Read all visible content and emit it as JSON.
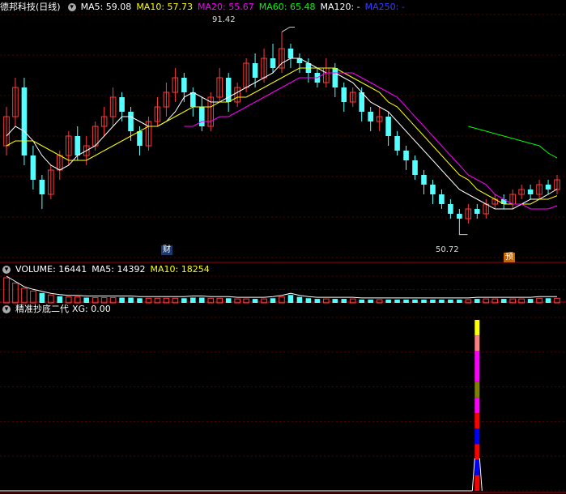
{
  "header": {
    "stock_name": "德邦科技",
    "period": "(日线)",
    "ma_labels": [
      {
        "text": "MA5: 59.08",
        "color": "#ffffff"
      },
      {
        "text": "MA10: 57.73",
        "color": "#ffff00"
      },
      {
        "text": "MA20: 55.67",
        "color": "#ff00ff"
      },
      {
        "text": "MA60: 65.48",
        "color": "#00ff00"
      },
      {
        "text": "MA120: -",
        "color": "#ffffff"
      },
      {
        "text": "MA250: -",
        "color": "#3b3bff"
      }
    ]
  },
  "volume_header": {
    "title": "VOLUME: 16441",
    "ma5": "MA5: 14392",
    "ma10": "MA10: 18254"
  },
  "indicator_header": {
    "title": "精准抄底二代",
    "xg": "XG: 0.00"
  },
  "markers": {
    "high": "91.42",
    "low": "50.72",
    "cai": "财",
    "yu": "预"
  },
  "colors": {
    "up": "#ff3b3b",
    "down": "#54ffff",
    "grid": "#5a0000",
    "ma5": "#ffffff",
    "ma10": "#ffff00",
    "ma20": "#ff00ff",
    "ma60": "#00ff00"
  },
  "chart_data": [
    {
      "type": "candlestick",
      "title": "德邦科技 (日线)",
      "ylim": [
        45,
        95
      ],
      "candles": [
        [
          68,
          74,
          66,
          76,
          "up"
        ],
        [
          74,
          80,
          72,
          82,
          "up"
        ],
        [
          80,
          66,
          64,
          82,
          "down"
        ],
        [
          66,
          61,
          59,
          68,
          "down"
        ],
        [
          61,
          58,
          55,
          62,
          "down"
        ],
        [
          58,
          63,
          57,
          64,
          "up"
        ],
        [
          63,
          66,
          61,
          67,
          "up"
        ],
        [
          66,
          70,
          64,
          71,
          "up"
        ],
        [
          70,
          66,
          65,
          72,
          "down"
        ],
        [
          66,
          68,
          64,
          70,
          "up"
        ],
        [
          68,
          72,
          67,
          73,
          "up"
        ],
        [
          72,
          74,
          70,
          76,
          "up"
        ],
        [
          74,
          78,
          72,
          80,
          "up"
        ],
        [
          78,
          75,
          73,
          79,
          "down"
        ],
        [
          75,
          71,
          69,
          76,
          "down"
        ],
        [
          71,
          68,
          66,
          72,
          "down"
        ],
        [
          68,
          73,
          67,
          74,
          "up"
        ],
        [
          73,
          76,
          72,
          78,
          "up"
        ],
        [
          76,
          79,
          74,
          81,
          "up"
        ],
        [
          79,
          82,
          77,
          84,
          "up"
        ],
        [
          82,
          79,
          77,
          83,
          "down"
        ],
        [
          79,
          76,
          74,
          80,
          "down"
        ],
        [
          76,
          72,
          71,
          78,
          "down"
        ],
        [
          72,
          78,
          71,
          79,
          "up"
        ],
        [
          78,
          82,
          77,
          84,
          "up"
        ],
        [
          82,
          77,
          75,
          83,
          "down"
        ],
        [
          77,
          80,
          76,
          81,
          "up"
        ],
        [
          80,
          85,
          79,
          86,
          "up"
        ],
        [
          85,
          82,
          80,
          87,
          "down"
        ],
        [
          82,
          86,
          81,
          88,
          "up"
        ],
        [
          86,
          84,
          83,
          89,
          "down"
        ],
        [
          84,
          88,
          83,
          91.42,
          "up"
        ],
        [
          88,
          86,
          84,
          89,
          "down"
        ],
        [
          86,
          85,
          83,
          87,
          "down"
        ],
        [
          85,
          83,
          81,
          86,
          "down"
        ],
        [
          83,
          81,
          80,
          84,
          "down"
        ],
        [
          81,
          84,
          80,
          86,
          "up"
        ],
        [
          84,
          80,
          78,
          85,
          "down"
        ],
        [
          80,
          77,
          75,
          81,
          "down"
        ],
        [
          77,
          79,
          76,
          80,
          "up"
        ],
        [
          79,
          75,
          73,
          80,
          "down"
        ],
        [
          75,
          73,
          71,
          76,
          "down"
        ],
        [
          73,
          74,
          71,
          76,
          "up"
        ],
        [
          74,
          70,
          68,
          75,
          "down"
        ],
        [
          70,
          67,
          66,
          71,
          "down"
        ],
        [
          67,
          65,
          63,
          68,
          "down"
        ],
        [
          65,
          62,
          61,
          66,
          "down"
        ],
        [
          62,
          60,
          58,
          63,
          "down"
        ],
        [
          60,
          58,
          56,
          61,
          "down"
        ],
        [
          58,
          56,
          55,
          59,
          "down"
        ],
        [
          56,
          54,
          53,
          57,
          "down"
        ],
        [
          54,
          53,
          50.72,
          55,
          "down"
        ],
        [
          53,
          55,
          52,
          56,
          "up"
        ],
        [
          55,
          54,
          53,
          56,
          "down"
        ],
        [
          54,
          56,
          53,
          57,
          "up"
        ],
        [
          56,
          57,
          55,
          58,
          "up"
        ],
        [
          57,
          56,
          55,
          58,
          "down"
        ],
        [
          56,
          58,
          55,
          59,
          "up"
        ],
        [
          58,
          59,
          57,
          60,
          "up"
        ],
        [
          59,
          58,
          57,
          60,
          "down"
        ],
        [
          58,
          60,
          57,
          61,
          "up"
        ],
        [
          60,
          59,
          58,
          61,
          "down"
        ],
        [
          59,
          61,
          58,
          62,
          "up"
        ]
      ],
      "series": [
        {
          "name": "MA5",
          "values": [
            70,
            72,
            71,
            69,
            66,
            64,
            63,
            64,
            66,
            67,
            68,
            70,
            72,
            74,
            74,
            73,
            72,
            72,
            73,
            75,
            78,
            79,
            78,
            77,
            77,
            78,
            79,
            80,
            81,
            82,
            83,
            85,
            86,
            86,
            85,
            84,
            83,
            83,
            82,
            81,
            79,
            77,
            76,
            75,
            73,
            71,
            69,
            67,
            65,
            63,
            61,
            59,
            58,
            57,
            56,
            55,
            55,
            55,
            56,
            57,
            57,
            58,
            59.08
          ]
        },
        {
          "name": "MA10",
          "values": [
            68,
            69,
            69,
            69,
            68,
            67,
            66,
            65,
            65,
            65,
            66,
            67,
            68,
            69,
            70,
            71,
            72,
            72,
            73,
            74,
            75,
            76,
            76,
            76,
            77,
            77,
            78,
            78,
            79,
            80,
            81,
            82,
            83,
            84,
            84,
            84,
            84,
            84,
            83,
            82,
            81,
            80,
            79,
            77,
            76,
            74,
            72,
            70,
            68,
            66,
            64,
            62,
            61,
            59,
            58,
            57,
            56,
            56,
            56,
            56,
            57,
            57,
            57.73
          ]
        },
        {
          "name": "MA20",
          "values": [
            null,
            null,
            null,
            null,
            null,
            null,
            null,
            null,
            null,
            null,
            null,
            null,
            null,
            null,
            null,
            null,
            null,
            null,
            null,
            null,
            72,
            72,
            73,
            73,
            74,
            74,
            75,
            76,
            77,
            78,
            79,
            80,
            81,
            82,
            82,
            82,
            83,
            83,
            83,
            83,
            82,
            81,
            80,
            79,
            78,
            76,
            74,
            72,
            70,
            68,
            66,
            64,
            62,
            61,
            60,
            58,
            57,
            56,
            56,
            55,
            55,
            55,
            55.67
          ]
        },
        {
          "name": "MA60",
          "values": [
            null,
            null,
            null,
            null,
            null,
            null,
            null,
            null,
            null,
            null,
            null,
            null,
            null,
            null,
            null,
            null,
            null,
            null,
            null,
            null,
            null,
            null,
            null,
            null,
            null,
            null,
            null,
            null,
            null,
            null,
            null,
            null,
            null,
            null,
            null,
            null,
            null,
            null,
            null,
            null,
            null,
            null,
            null,
            null,
            null,
            null,
            null,
            null,
            null,
            null,
            null,
            null,
            72,
            71.5,
            71,
            70.5,
            70,
            69.5,
            69,
            68.5,
            68,
            66.5,
            65.48
          ]
        }
      ]
    },
    {
      "type": "bar",
      "title": "VOLUME",
      "values": [
        38,
        30,
        22,
        18,
        15,
        12,
        10,
        9,
        9,
        8,
        8,
        8,
        8,
        8,
        8,
        7,
        7,
        7,
        7,
        7,
        7,
        8,
        8,
        7,
        7,
        7,
        6,
        6,
        6,
        6,
        7,
        9,
        12,
        9,
        7,
        6,
        6,
        6,
        6,
        6,
        5,
        5,
        5,
        5,
        5,
        5,
        5,
        5,
        5,
        5,
        5,
        5,
        5,
        6,
        6,
        6,
        6,
        6,
        6,
        6,
        7,
        7,
        7
      ],
      "colors": [
        "up",
        "up",
        "up",
        "up",
        "down",
        "up",
        "down",
        "up",
        "up",
        "down",
        "up",
        "up",
        "up",
        "down",
        "down",
        "down",
        "up",
        "up",
        "up",
        "up",
        "down",
        "down",
        "down",
        "up",
        "up",
        "down",
        "up",
        "up",
        "down",
        "up",
        "down",
        "up",
        "down",
        "down",
        "down",
        "down",
        "up",
        "down",
        "down",
        "up",
        "down",
        "down",
        "up",
        "down",
        "down",
        "down",
        "down",
        "down",
        "down",
        "down",
        "down",
        "down",
        "up",
        "down",
        "up",
        "up",
        "down",
        "up",
        "up",
        "down",
        "up",
        "down",
        "up"
      ]
    },
    {
      "type": "bar",
      "title": "精准抄底二代",
      "xg_index": 53,
      "segments": [
        "#ffff00",
        "#ff8080",
        "#ff00ff",
        "#ff00ff",
        "#808000",
        "#ff00ff",
        "#ff0000",
        "#0000ff",
        "#ff0000",
        "#0000ff",
        "#ff0000"
      ]
    }
  ]
}
